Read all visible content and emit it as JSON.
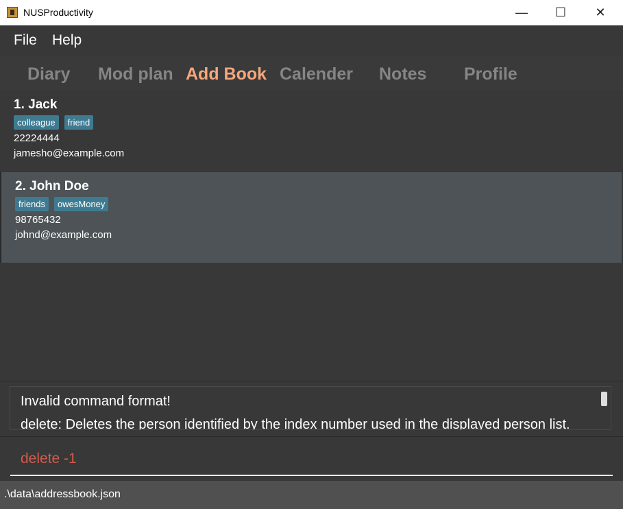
{
  "window": {
    "title": "NUSProductivity",
    "min_glyph": "—",
    "max_glyph": "☐",
    "close_glyph": "✕"
  },
  "menu": [
    "File",
    "Help"
  ],
  "tabs": [
    {
      "label": "Diary",
      "active": false
    },
    {
      "label": "Mod plan",
      "active": false
    },
    {
      "label": "Add Book",
      "active": true
    },
    {
      "label": "Calender",
      "active": false
    },
    {
      "label": "Notes",
      "active": false
    },
    {
      "label": "Profile",
      "active": false
    }
  ],
  "persons": [
    {
      "name": "1.  Jack",
      "tags": [
        "colleague",
        "friend"
      ],
      "phone": "22224444",
      "email": "jamesho@example.com"
    },
    {
      "name": "2.  John Doe",
      "tags": [
        "friends",
        "owesMoney"
      ],
      "phone": "98765432",
      "email": "johnd@example.com"
    }
  ],
  "result": {
    "line1": "Invalid command format!",
    "line2": "delete: Deletes the person identified by the index number used in the displayed person list."
  },
  "command": {
    "value": "delete -1"
  },
  "status": {
    "path": ".\\data\\addressbook.json"
  },
  "colors": {
    "accent": "#f6a77b",
    "tag": "#3e7b91",
    "error_text": "#d15a4e",
    "selected_card": "#4d5356"
  }
}
